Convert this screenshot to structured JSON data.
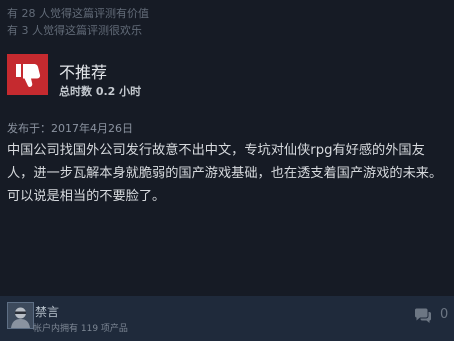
{
  "helpful": {
    "line1": "有 28 人觉得这篇评测有价值",
    "line2": "有 3 人觉得这篇评测很欢乐"
  },
  "review": {
    "verdict": "不推荐",
    "playtime": "总时数 0.2 小时",
    "posted": "发布于：2017年4月26日",
    "body": "中国公司找国外公司发行故意不出中文，专坑对仙侠rpg有好感的外国友人，进一步瓦解本身就脆弱的国产游戏基础，也在透支着国产游戏的未来。可以说是相当的不要脸了。",
    "verdict_color": "#c52a2f"
  },
  "author": {
    "name": "禁言",
    "products": "帐户内拥有 119 项产品"
  },
  "comments": {
    "count": "0"
  },
  "icons": {
    "verdict": "thumbs-down-icon",
    "comment": "comment-bubble-icon",
    "avatar": "user-avatar"
  }
}
